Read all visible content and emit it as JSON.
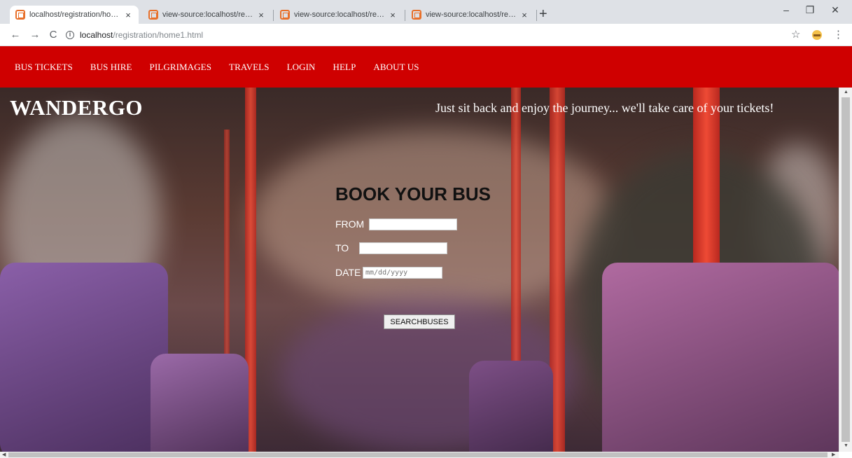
{
  "browser": {
    "tabs": [
      {
        "title": "localhost/registration/home1.htm",
        "active": true
      },
      {
        "title": "view-source:localhost/registratio",
        "active": false
      },
      {
        "title": "view-source:localhost/registratio",
        "active": false
      },
      {
        "title": "view-source:localhost/registratio",
        "active": false
      }
    ],
    "new_tab": "+",
    "close": "×",
    "url_host": "localhost",
    "url_path": "/registration/home1.html",
    "back": "←",
    "forward": "→",
    "reload": "C",
    "minimize": "–",
    "restore": "❐",
    "window_close": "✕",
    "star": "☆",
    "menu": "⋮",
    "info": "i"
  },
  "site": {
    "nav": [
      "BUS TICKETS",
      "BUS HIRE",
      "PILGRIMAGES",
      "TRAVELS",
      "LOGIN",
      "HELP",
      "ABOUT US"
    ],
    "brand": "WANDERGO",
    "tagline": "Just sit back and enjoy the journey... we'll take care of your tickets!",
    "booking": {
      "title": "BOOK YOUR BUS",
      "from_label": "FROM",
      "to_label": "TO",
      "date_label": "DATE",
      "date_placeholder": "mm/dd/yyyy",
      "from_value": "",
      "to_value": "",
      "search_button": "SEARCHBUSES"
    }
  },
  "colors": {
    "nav_bg": "#cf0000",
    "accent_pole": "#ee4a35"
  }
}
